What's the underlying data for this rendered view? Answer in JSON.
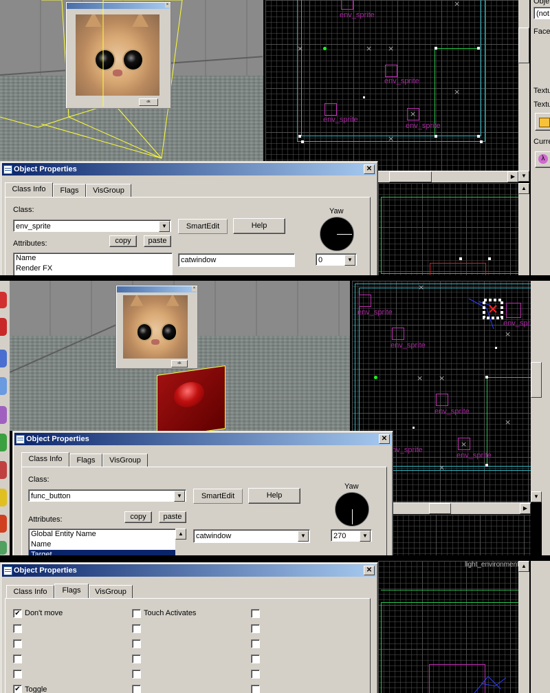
{
  "panels": [
    {
      "dialog": {
        "title": "Object Properties",
        "close_glyph": "✕",
        "tabs": [
          "Class Info",
          "Flags",
          "VisGroup"
        ],
        "class_label": "Class:",
        "class_value": "env_sprite",
        "smartedit_label": "SmartEdit",
        "help_label": "Help",
        "yaw_label": "Yaw",
        "copy_label": "copy",
        "paste_label": "paste",
        "attributes_label": "Attributes:",
        "attributes": [
          "Name",
          "Render FX"
        ],
        "value_field": "catwindow",
        "yaw_value": "0"
      },
      "sprite_labels": [
        "env_sprite",
        "env_sprite",
        "env_sprite",
        "env_sprite"
      ],
      "side_texts": [
        "Obje",
        "(not",
        "Faces",
        "Textu",
        "Textu",
        "Curre"
      ]
    },
    {
      "dialog": {
        "title": "Object Properties",
        "close_glyph": "✕",
        "tabs": [
          "Class Info",
          "Flags",
          "VisGroup"
        ],
        "class_label": "Class:",
        "class_value": "func_button",
        "smartedit_label": "SmartEdit",
        "help_label": "Help",
        "yaw_label": "Yaw",
        "copy_label": "copy",
        "paste_label": "paste",
        "attributes_label": "Attributes:",
        "attributes": [
          "Global Entity Name",
          "Name",
          "Target"
        ],
        "selected_attribute": 2,
        "value_field": "catwindow",
        "yaw_value": "270"
      },
      "sprite_labels": [
        "env_sprite",
        "env_sprite",
        "env_sprite",
        "env_sprite",
        "env_spr",
        "env_sprite"
      ]
    },
    {
      "dialog": {
        "title": "Object Properties",
        "close_glyph": "✕",
        "tabs": [
          "Class Info",
          "Flags",
          "VisGroup"
        ],
        "flags": {
          "col1": [
            {
              "label": "Don't move",
              "checked": true
            },
            {
              "label": "",
              "checked": false
            },
            {
              "label": "",
              "checked": false
            },
            {
              "label": "",
              "checked": false
            },
            {
              "label": "Toggle",
              "checked": true
            }
          ],
          "col2": [
            {
              "label": "Touch Activates",
              "checked": false
            },
            {
              "label": "",
              "checked": false
            },
            {
              "label": "",
              "checked": false
            },
            {
              "label": "",
              "checked": false
            },
            {
              "label": "",
              "checked": false
            }
          ],
          "col3": [
            {
              "label": "",
              "checked": false
            },
            {
              "label": "",
              "checked": false
            },
            {
              "label": "",
              "checked": false
            },
            {
              "label": "",
              "checked": false
            },
            {
              "label": "",
              "checked": false
            }
          ]
        },
        "check_glyph": "✔"
      },
      "entity_label": "light_environment"
    }
  ],
  "glyphs": {
    "down_arrow": "▼",
    "up_arrow": "▲",
    "left_arrow": "◀",
    "right_arrow": "▶",
    "x_mark": "×"
  },
  "colors": {
    "titlebar_start": "#0a246a",
    "titlebar_end": "#a6caf0",
    "grid_cyan": "#2fb8c4",
    "grid_green": "#27c44a",
    "sprite_magenta": "#c02fb4",
    "window_bg": "#d4d0c8"
  }
}
